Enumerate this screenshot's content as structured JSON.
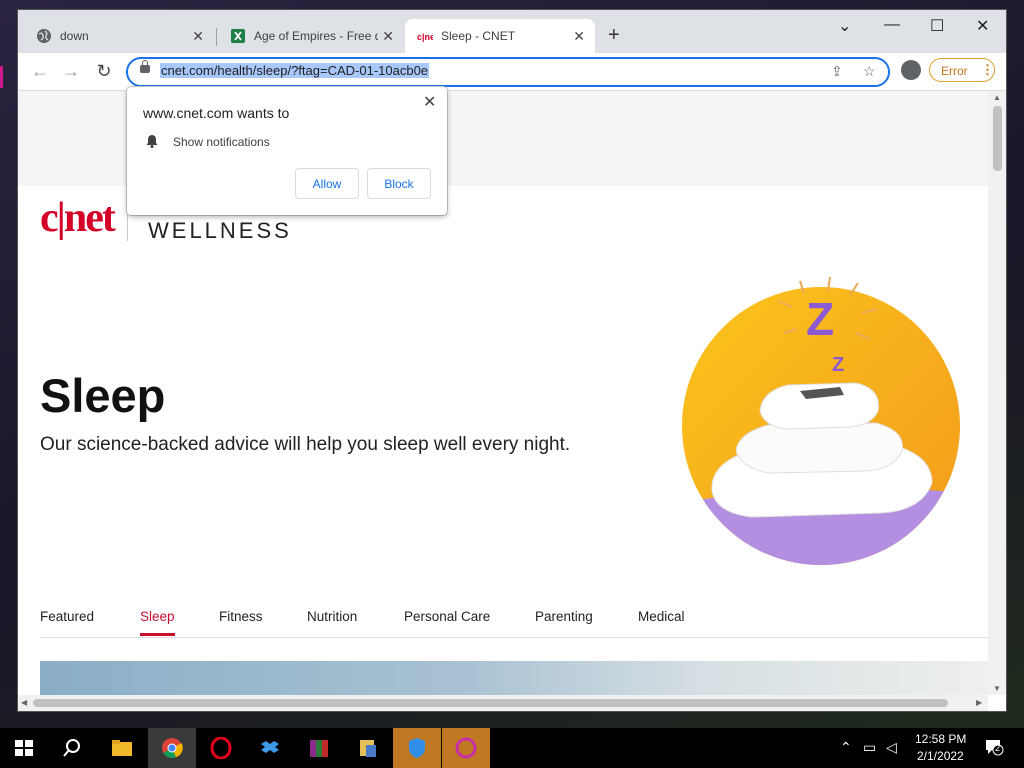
{
  "browser": {
    "tabs": [
      {
        "title": "down",
        "icon": "globe-icon"
      },
      {
        "title": "Age of Empires - Free d",
        "icon": "spreadsheet-icon"
      },
      {
        "title": "Sleep - CNET",
        "icon": "cnet-favicon"
      }
    ],
    "new_tab": "+",
    "url": "cnet.com/health/sleep/?ftag=CAD-01-10acb0e",
    "error_label": "Error",
    "menu_dots": "⋮"
  },
  "notification_prompt": {
    "title": "www.cnet.com wants to",
    "permission": "Show notifications",
    "allow": "Allow",
    "block": "Block"
  },
  "page": {
    "logo": "c|net",
    "section": "WELLNESS",
    "heading": "Sleep",
    "subheading": "Our science-backed advice will help you sleep well every night.",
    "nav": [
      "Featured",
      "Sleep",
      "Fitness",
      "Nutrition",
      "Personal Care",
      "Parenting",
      "Medical"
    ],
    "active_nav": "Sleep"
  },
  "taskbar": {
    "apps": [
      "file-explorer-icon",
      "chrome-icon",
      "opera-icon",
      "dropbox-icon",
      "winrar-icon",
      "installer-icon",
      "shield-icon",
      "opera-gx-icon"
    ],
    "time": "12:58 PM",
    "date": "2/1/2022",
    "notifications": "2"
  },
  "colors": {
    "accent": "#c8102e",
    "chrome_blue": "#1a73e8",
    "error_orange": "#c5761a"
  }
}
